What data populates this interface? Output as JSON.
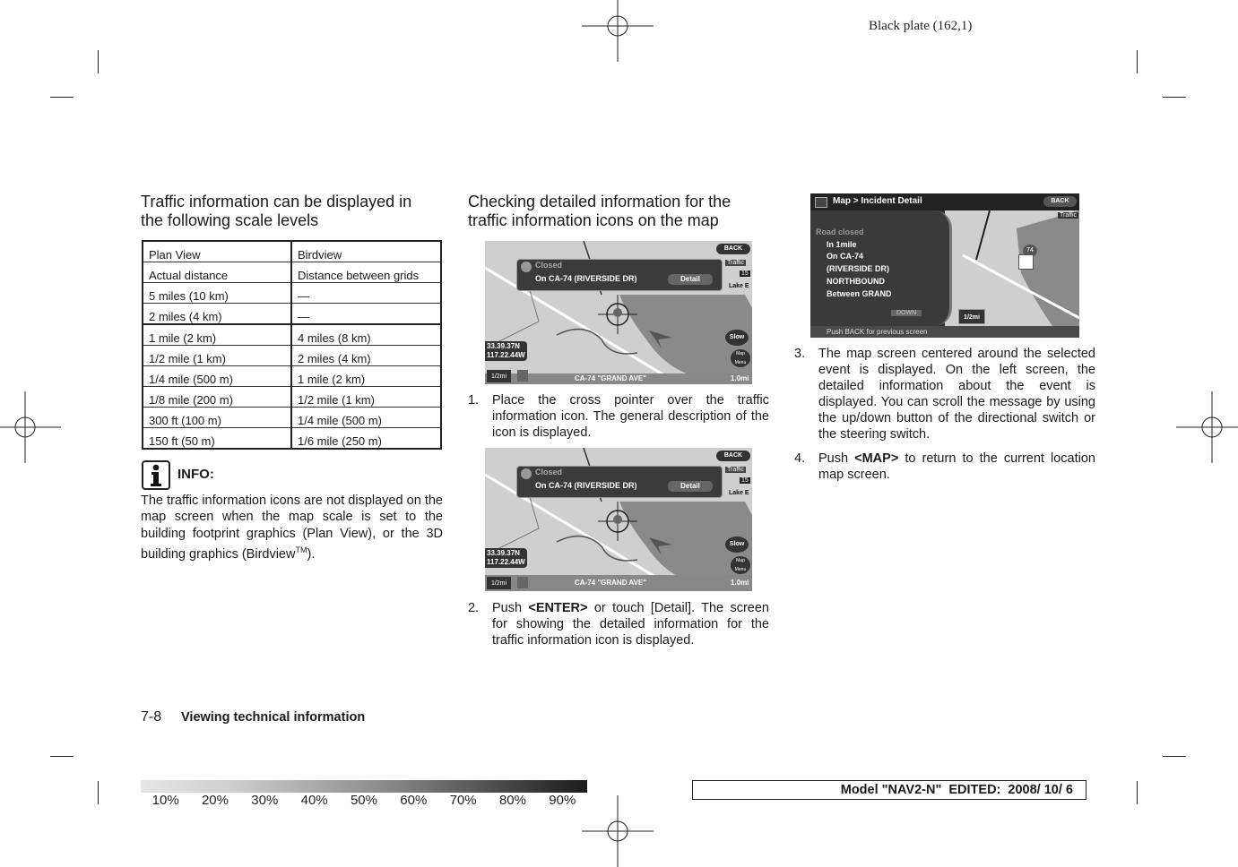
{
  "plate_label": "Black plate (162,1)",
  "col1": {
    "heading_line1": "Traffic information can be displayed in",
    "heading_line2": "the following scale levels",
    "table": {
      "rows": [
        [
          "Plan View",
          "Birdview"
        ],
        [
          "Actual distance",
          "Distance between grids"
        ],
        [
          "5 miles (10 km)",
          "—"
        ],
        [
          "2 miles (4 km)",
          "—"
        ],
        [
          "1 mile (2 km)",
          "4 miles (8 km)"
        ],
        [
          "1/2 mile (1 km)",
          "2 miles (4 km)"
        ],
        [
          "1/4 mile (500 m)",
          "1 mile (2 km)"
        ],
        [
          "1/8 mile (200 m)",
          "1/2 mile (1 km)"
        ],
        [
          "300 ft (100 m)",
          "1/4 mile (500 m)"
        ],
        [
          "150 ft (50 m)",
          "1/6 mile (250 m)"
        ]
      ]
    },
    "info": {
      "icon": "info-icon",
      "title": "INFO:",
      "body": "The traffic information icons are not displayed on the map screen when the map scale is set to the building footprint graphics (Plan View), or the 3D building graphics (Birdview",
      "superscript": "TM",
      "body_end": ")."
    }
  },
  "col2": {
    "heading_line1": "Checking detailed information for the",
    "heading_line2": "traffic information icons on the map",
    "screen1": {
      "popup_title": "Closed",
      "popup_text": "On CA-74 (RIVERSIDE DR)",
      "detail_button": "Detail",
      "back_button": "BACK",
      "traffic_label": "Traffic",
      "route_shield": "15",
      "place_label": "Lake E",
      "lat": "33.39.37N",
      "lon": "117.22.44W",
      "scale": "1/2mi",
      "street": "CA-74 \"GRAND AVE\"",
      "distance": "1.0mi",
      "slow_button": "Slow",
      "map_menu_button": "Map Menu"
    },
    "step1_num": "1.",
    "step1_text": "Place the cross pointer over the traffic information icon. The general description of the icon is displayed.",
    "step2_num": "2.",
    "step2_pre": "Push ",
    "step2_bold": "<ENTER>",
    "step2_post": " or touch [Detail]. The screen for showing the detailed information for the traffic information icon is displayed."
  },
  "col3": {
    "screen": {
      "breadcrumb": "Map > Incident Detail",
      "back_button": "BACK",
      "traffic_label": "Traffic",
      "lines": [
        "Road closed",
        "In 1mile",
        "On CA-74",
        "(RIVERSIDE DR)",
        "NORTHBOUND",
        "Between GRAND"
      ],
      "down_button": "DOWN",
      "scale": "1/2mi",
      "shield": "74",
      "hint": "Push BACK for previous screen"
    },
    "step3_num": "3.",
    "step3_text": "The map screen centered around the selected event is displayed. On the left screen, the detailed information about the event is displayed. You can scroll the message by using the up/down button of the directional switch or the steering switch.",
    "step4_num": "4.",
    "step4_pre": "Push ",
    "step4_bold": "<MAP>",
    "step4_post": " to return to the current location map screen."
  },
  "footer": {
    "page_number": "7-8",
    "section_title": "Viewing technical information",
    "gray_scale_labels": [
      "10%",
      "20%",
      "30%",
      "40%",
      "50%",
      "60%",
      "70%",
      "80%",
      "90%"
    ],
    "model_text": "Model \"NAV2-N\"  EDITED:  2008/ 10/ 6"
  }
}
